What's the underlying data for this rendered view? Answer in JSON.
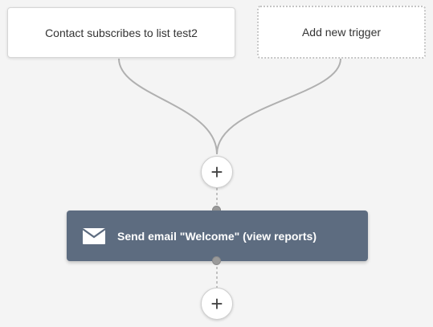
{
  "triggers": {
    "existing_label": "Contact subscribes to list test2",
    "add_label": "Add new trigger"
  },
  "add_step_symbol": "+",
  "action": {
    "icon": "envelope-icon",
    "label": "Send email \"Welcome\" (view reports)"
  },
  "colors": {
    "background": "#f4f4f4",
    "action_fill": "#5d6c80",
    "connector": "#b0b0b0"
  }
}
